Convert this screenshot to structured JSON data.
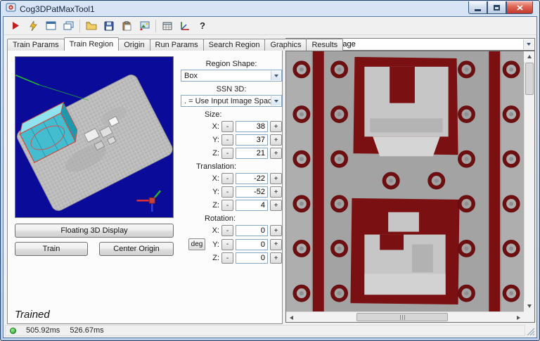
{
  "window": {
    "title": "Cog3DPatMaxTool1"
  },
  "toolbar": {
    "items": [
      {
        "name": "run-button"
      },
      {
        "name": "run-continuous-button"
      },
      {
        "name": "image-display-button"
      },
      {
        "name": "float-window-button"
      },
      {
        "name": "open-button"
      },
      {
        "name": "save-button"
      },
      {
        "name": "paste-button"
      },
      {
        "name": "import-image-button"
      },
      {
        "name": "results-table-button"
      },
      {
        "name": "origin-tool-button"
      },
      {
        "name": "help-button",
        "glyph": "?"
      }
    ]
  },
  "tabs": [
    {
      "label": "Train Params"
    },
    {
      "label": "Train Region"
    },
    {
      "label": "Origin"
    },
    {
      "label": "Run Params"
    },
    {
      "label": "Search Region"
    },
    {
      "label": "Graphics"
    },
    {
      "label": "Results"
    }
  ],
  "active_tab": "Train Region",
  "left": {
    "floating_button": "Floating 3D Display",
    "train_button": "Train",
    "center_origin_button": "Center Origin",
    "trained_status": "Trained"
  },
  "form": {
    "region_shape_label": "Region Shape:",
    "region_shape_value": "Box",
    "ssn_label": "SSN 3D:",
    "ssn_value": ". = Use Input Image Space",
    "size_label": "Size:",
    "translation_label": "Translation:",
    "rotation_label": "Rotation:",
    "deg_button": "deg",
    "minus": "-",
    "plus": "+",
    "size_rows": [
      {
        "label": "X:",
        "value": "38"
      },
      {
        "label": "Y:",
        "value": "37"
      },
      {
        "label": "Z:",
        "value": "21"
      }
    ],
    "translation_rows": [
      {
        "label": "X:",
        "value": "-22"
      },
      {
        "label": "Y:",
        "value": "-52"
      },
      {
        "label": "Z:",
        "value": "4"
      }
    ],
    "rotation_rows": [
      {
        "label": "X:",
        "value": "0"
      },
      {
        "label": "Y:",
        "value": "0"
      },
      {
        "label": "Z:",
        "value": "0"
      }
    ]
  },
  "right_panel": {
    "image_selector": "Current.InputImage"
  },
  "status": {
    "time1": "505.92ms",
    "time2": "526.67ms"
  }
}
